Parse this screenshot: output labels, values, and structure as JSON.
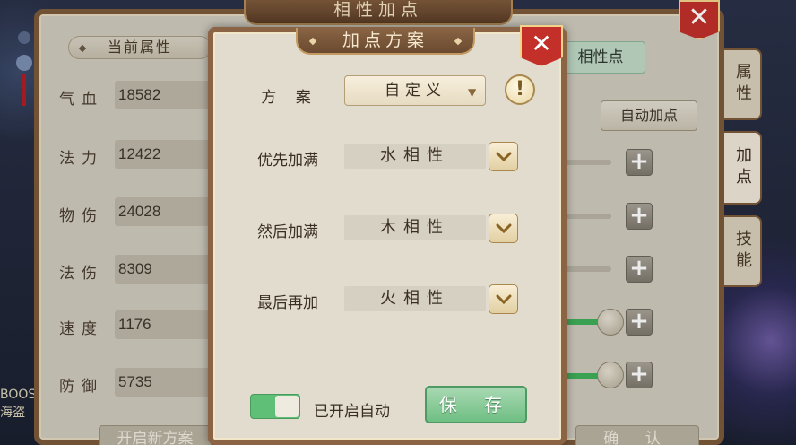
{
  "window": {
    "title": "相性加点",
    "close_icon": "close-icon"
  },
  "left_panel": {
    "header": "当前属性",
    "stats": [
      {
        "label": "气血",
        "value": "18582"
      },
      {
        "label": "法力",
        "value": "12422"
      },
      {
        "label": "物伤",
        "value": "24028"
      },
      {
        "label": "法伤",
        "value": "8309"
      },
      {
        "label": "速度",
        "value": "1176"
      },
      {
        "label": "防御",
        "value": "5735"
      }
    ],
    "open_plan_button": "开启新方案"
  },
  "right_panel": {
    "phase_button": "相性点",
    "auto_button": "自动加点",
    "confirm_button": "确 认"
  },
  "side_tabs": [
    {
      "label": "属性"
    },
    {
      "label": "加点"
    },
    {
      "label": "技能"
    }
  ],
  "left_edge_text": "BOOS 海盗",
  "dialog": {
    "title": "加点方案",
    "scheme_label": "方 案",
    "scheme_value": "自定义",
    "rows": [
      {
        "label": "优先加满",
        "value": "水相性"
      },
      {
        "label": "然后加满",
        "value": "木相性"
      },
      {
        "label": "最后再加",
        "value": "火相性"
      }
    ],
    "auto_toggle_label": "已开启自动",
    "auto_toggle_on": true,
    "save_button": "保 存"
  },
  "colors": {
    "accent_red": "#c23029",
    "save_green": "#6fbf83",
    "panel_brown": "#8a6444"
  }
}
